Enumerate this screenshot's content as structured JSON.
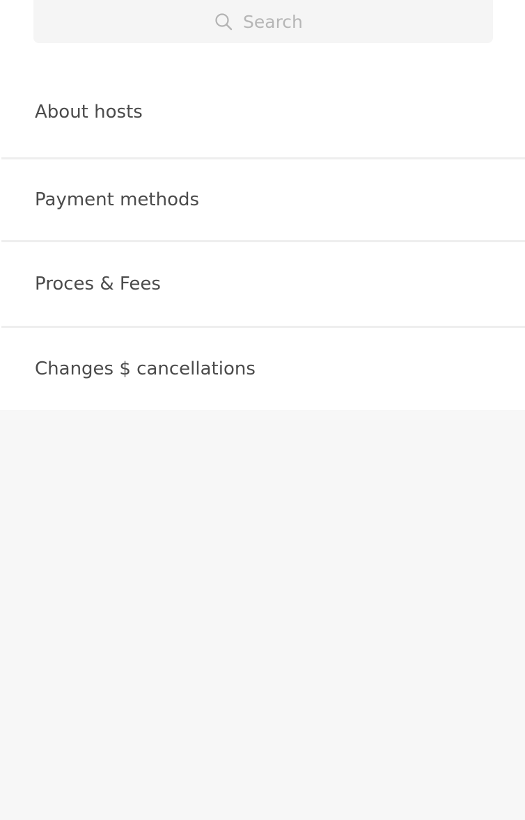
{
  "search": {
    "placeholder": "Search",
    "icon": "search-icon"
  },
  "list": {
    "items": [
      {
        "label": "About hosts"
      },
      {
        "label": "Payment methods"
      },
      {
        "label": "Proces & Fees"
      },
      {
        "label": "Changes $ cancellations"
      }
    ]
  },
  "colors": {
    "background": "#f7f7f7",
    "surface": "#ffffff",
    "text": "#4b4b4b",
    "placeholder": "#b6b6b6",
    "divider": "#eeeeee"
  }
}
